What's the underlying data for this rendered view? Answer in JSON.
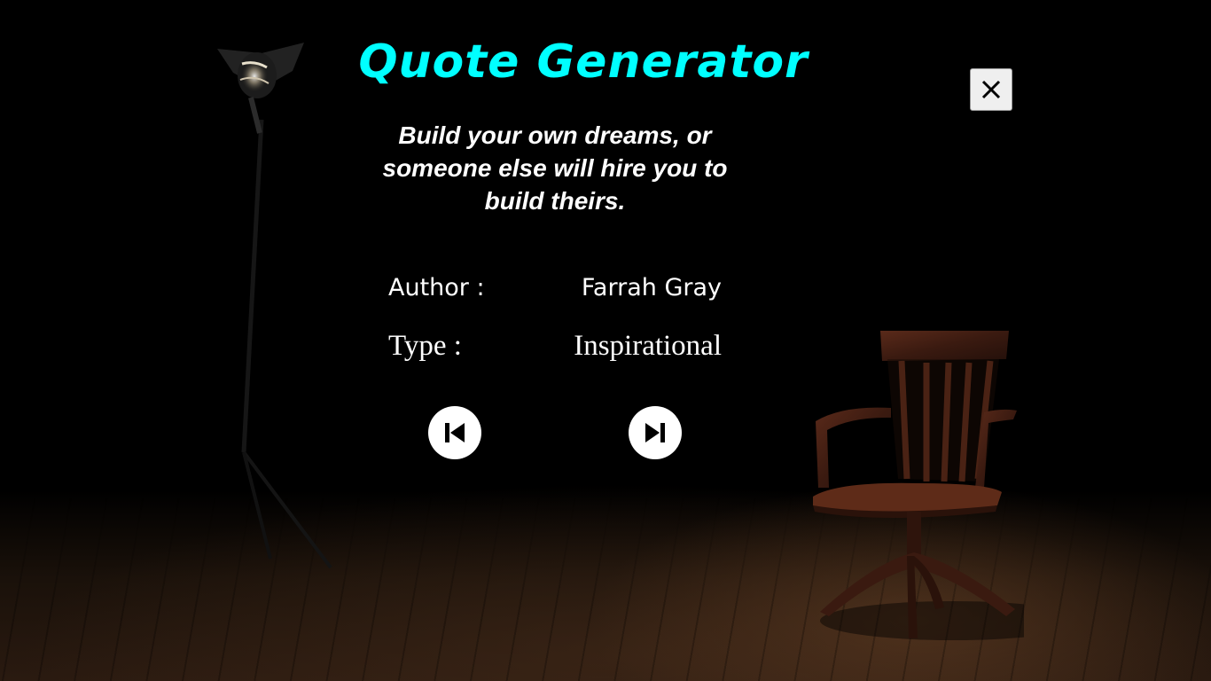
{
  "header": {
    "title": "Quote Generator",
    "title_color": "#00ffff",
    "close_icon": "close-icon"
  },
  "quote": {
    "text": "Build your own dreams, or someone else will hire you to build theirs."
  },
  "details": {
    "author_label": "Author :",
    "author_value": "Farrah Gray",
    "type_label": "Type :",
    "type_value": "Inspirational"
  },
  "controls": {
    "previous_icon": "skip-previous-icon",
    "next_icon": "skip-next-icon"
  },
  "background": {
    "scene": "dark stage with spotlight lamp, wooden chair and plank floor",
    "floor_color": "#3a2515"
  }
}
